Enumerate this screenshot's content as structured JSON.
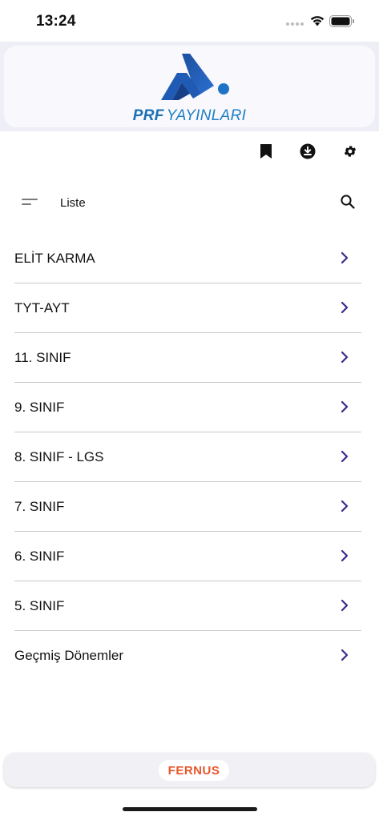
{
  "status_bar": {
    "time": "13:24"
  },
  "header": {
    "brand_bold": "PRF",
    "brand_rest": "YAYINLARI"
  },
  "toolbar": {
    "icons": [
      "bookmark-icon",
      "download-icon",
      "gear-icon"
    ]
  },
  "search": {
    "label": "Liste"
  },
  "list": {
    "items": [
      {
        "label": "ELİT KARMA"
      },
      {
        "label": "TYT-AYT"
      },
      {
        "label": "11. SINIF"
      },
      {
        "label": "9. SINIF"
      },
      {
        "label": "8. SINIF - LGS"
      },
      {
        "label": "7. SINIF"
      },
      {
        "label": "6. SINIF"
      },
      {
        "label": "5. SINIF"
      },
      {
        "label": "Geçmiş Dönemler"
      }
    ]
  },
  "footer": {
    "sponsor": "FERNUS"
  },
  "colors": {
    "accent": "#3b2a8c",
    "brand_blue": "#1e7fc4",
    "fernus_orange": "#e8562a"
  }
}
